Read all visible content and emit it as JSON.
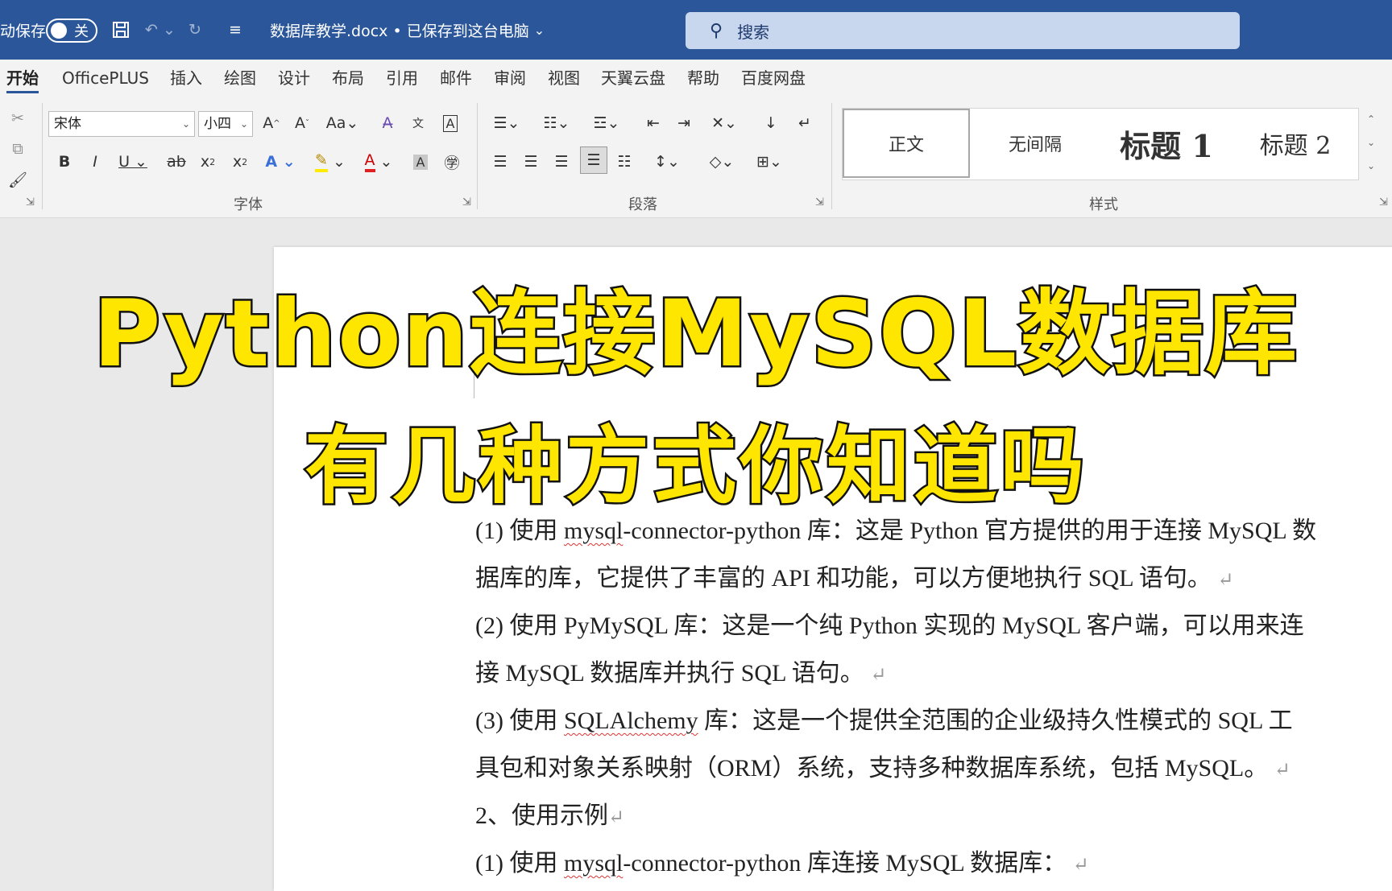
{
  "titlebar": {
    "autosave_label": "动保存",
    "autosave_state": "关",
    "document_title": "数据库教学.docx • 已保存到这台电脑",
    "search_placeholder": "搜索"
  },
  "tabs": [
    {
      "label": "开始",
      "active": true
    },
    {
      "label": "OfficePLUS"
    },
    {
      "label": "插入"
    },
    {
      "label": "绘图"
    },
    {
      "label": "设计"
    },
    {
      "label": "布局"
    },
    {
      "label": "引用"
    },
    {
      "label": "邮件"
    },
    {
      "label": "审阅"
    },
    {
      "label": "视图"
    },
    {
      "label": "天翼云盘"
    },
    {
      "label": "帮助"
    },
    {
      "label": "百度网盘"
    }
  ],
  "ribbon": {
    "font_name": "宋体",
    "font_size": "小四",
    "groups": {
      "font": "字体",
      "paragraph": "段落",
      "styles": "样式"
    },
    "styles": [
      "正文",
      "无间隔",
      "标题 1",
      "标题 2"
    ]
  },
  "document": {
    "lines": [
      {
        "prefix": "(1)  使用 ",
        "squig": "mysql",
        "suffix": "-connector-python 库：这是 Python 官方提供的用于连接 MySQL 数",
        "mark": ""
      },
      {
        "prefix": "据库的库，它提供了丰富的 API 和功能，可以方便地执行 SQL 语句。",
        "squig": "",
        "suffix": "",
        "mark": "↵"
      },
      {
        "prefix": "(2)  使用 PyMySQL 库：这是一个纯 Python 实现的 MySQL 客户端，可以用来连",
        "squig": "",
        "suffix": "",
        "mark": ""
      },
      {
        "prefix": "接 MySQL 数据库并执行 SQL 语句。",
        "squig": "",
        "suffix": "",
        "mark": "↵"
      },
      {
        "prefix": "(3)  使用 ",
        "squig": "SQLAlchemy",
        "suffix": " 库：这是一个提供全范围的企业级持久性模式的 SQL 工",
        "mark": ""
      },
      {
        "prefix": "具包和对象关系映射（ORM）系统，支持多种数据库系统，包括 MySQL。",
        "squig": "",
        "suffix": "",
        "mark": "↵"
      },
      {
        "prefix": "2、使用示例",
        "squig": "",
        "suffix": "",
        "mark": "↵"
      },
      {
        "prefix": "(1)  使用 ",
        "squig": "mysql",
        "suffix": "-connector-python 库连接 MySQL 数据库：",
        "mark": "↵"
      }
    ]
  },
  "overlay": {
    "line1": "Python连接MySQL数据库",
    "line2": "有几种方式你知道吗"
  }
}
